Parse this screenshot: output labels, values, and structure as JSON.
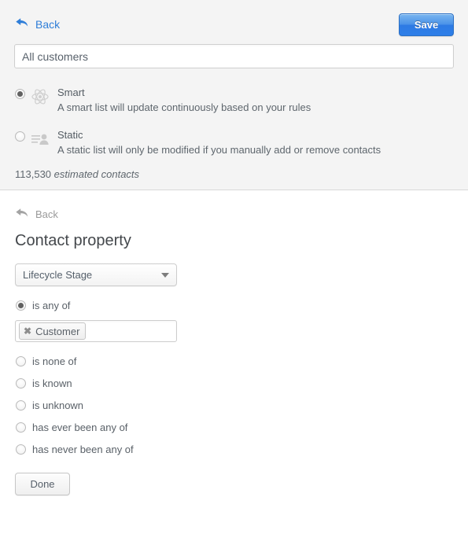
{
  "top_panel": {
    "back": {
      "label": "Back",
      "icon": "back-arrow-icon"
    },
    "save_button": "Save",
    "list_name": {
      "value": "All customers",
      "placeholder": "Name your list"
    },
    "list_types": [
      {
        "id": "smart",
        "title": "Smart",
        "description": "A smart list will update continuously based on your rules",
        "icon": "atom-icon",
        "selected": true
      },
      {
        "id": "static",
        "title": "Static",
        "description": "A static list will only be modified if you manually add or remove contacts",
        "icon": "contact-list-icon",
        "selected": false
      }
    ],
    "estimate": {
      "count": "113,530",
      "label": "estimated contacts"
    }
  },
  "bottom_panel": {
    "back": {
      "label": "Back",
      "icon": "back-arrow-icon"
    },
    "title": "Contact property",
    "property_select": {
      "value": "Lifecycle Stage",
      "caret_icon": "chevron-down-icon"
    },
    "operators": [
      {
        "id": "is-any-of",
        "label": "is any of",
        "selected": true
      },
      {
        "id": "is-none-of",
        "label": "is none of",
        "selected": false
      },
      {
        "id": "is-known",
        "label": "is known",
        "selected": false
      },
      {
        "id": "is-unknown",
        "label": "is unknown",
        "selected": false
      },
      {
        "id": "has-ever-been-any-of",
        "label": "has ever been any of",
        "selected": false
      },
      {
        "id": "has-never-been-any-of",
        "label": "has never been any of",
        "selected": false
      }
    ],
    "value_field": {
      "tokens": [
        {
          "label": "Customer",
          "remove_icon": "close-icon",
          "remove_glyph": "✖"
        }
      ],
      "placeholder": ""
    },
    "done_button": "Done"
  },
  "colors": {
    "accent_blue": "#2f7ed8",
    "panel_background": "#f4f4f4",
    "page_background": "#ffffff",
    "text": "#5a6168"
  }
}
